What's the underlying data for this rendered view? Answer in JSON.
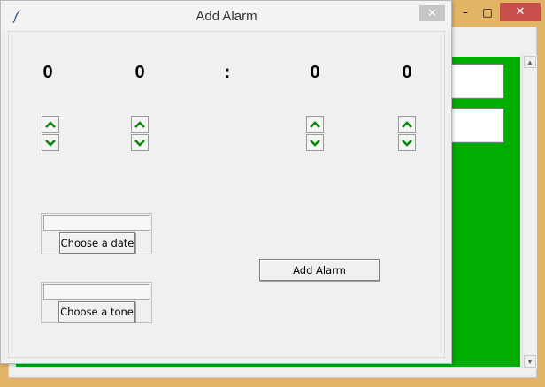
{
  "background_window": {
    "controls": {
      "minimize": "–",
      "maximize": "□",
      "close": "✕"
    },
    "scrollbar": {
      "up": "▲",
      "down": "▼"
    },
    "colors": {
      "frame": "#e3b465",
      "panel": "#00ad00",
      "close": "#c7504c"
    }
  },
  "dialog": {
    "title": "Add Alarm",
    "close_label": "✕",
    "time": {
      "hour_tens": "0",
      "hour_ones": "0",
      "separator": ":",
      "minute_tens": "0",
      "minute_ones": "0"
    },
    "date_picker": {
      "button_label": "Choose a date",
      "value": ""
    },
    "tone_picker": {
      "button_label": "Choose a tone",
      "value": ""
    },
    "add_button_label": "Add Alarm",
    "colors": {
      "arrow": "#0a8a0a"
    }
  }
}
